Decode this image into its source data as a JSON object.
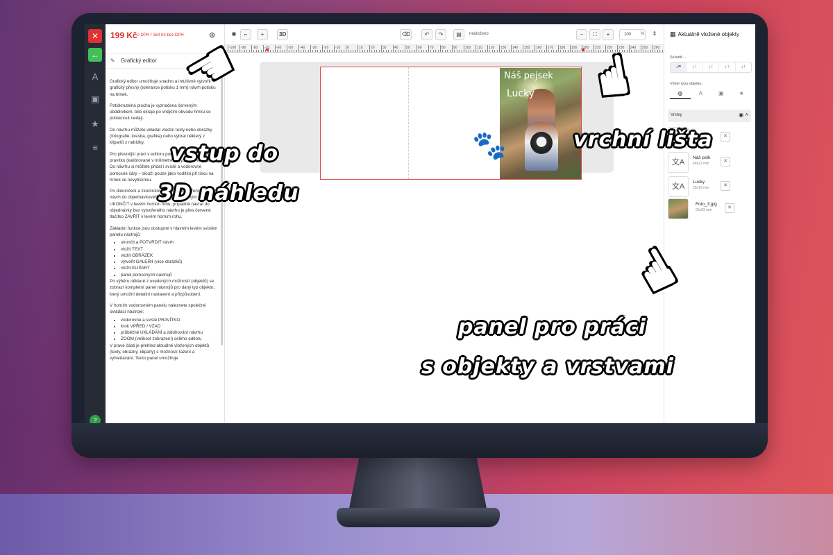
{
  "editor": {
    "price": "199 Kč",
    "price_note": "s DPH / 164 Kč bez DPH",
    "panel_title": "Grafický editor",
    "help": {
      "p1": "Grafický editor umožňuje snadno a intuitivně vytvořit grafický přesný (tolerance potisku 1 mm) návrh potisku na hrnek.",
      "p2": "Potisknutelná plocha je vyznačena červeným obdélníkem, bílé okraje po vnějším obvodu hrnku se potisknout nedají.",
      "p3": "Do návrhu můžete vkládat vlastní texty nebo obrázky (fotografie, kresba, grafika) nebo vybrat některý z klipartů z nabídky.",
      "p4": "Pro přesnější práci v editoru použijte svislé a vodorovné pravítko (kalibrované v milimetrech výsledného potisku). Do návrhu si můžete přidat i svislé a vodorovné pomocné čáry – slouží pouze jako vodítko při tisku na hrnek se nevytisknou.",
      "p5": "Po dokončení a zkontrolování vložte vytvořený grafický návrh do objednávkového formuláře zeleným tlačítkem UKONČIT v levém horním rohu, případně návrat do objednávky bez vytvořeného návrhu je přes červené tlačítko ZAVŘÍT v levém horním rohu.",
      "p6": "Základní funkce jsou dostupné v hlavním levém svislém panelu nástrojů:",
      "list1": [
        "ukončit a POTVRDIT návrh",
        "vložit TEXT",
        "vložit OBRÁZEK",
        "vytvořit GALERII (více obrázků)",
        "vložit KLIPART",
        "panel pomocných nástrojů"
      ],
      "p7": "Po výběru některé z uvedených možností (objektů) se zobrazí kompletní panel nástrojů pro daný typ objektu, který umožní detailní nastavení a přizpůsobení.",
      "p8": "V horním vodorovném panelu naleznete společné ovládací nástroje:",
      "list2": [
        "vodorovné a svislé PRAVÍTKO",
        "krok VPŘED / VZAD",
        "průběžné UKLÁDÁNÍ a zálohování návrhu",
        "ZOOM (velikost zobrazení) celého editoru"
      ],
      "p9": "V pravé části je přehled aktuálně vložených objektů (texty, obrázky, kliparty) s možností řazení a vyhledávání. Tento panel umožňuje"
    }
  },
  "toolbar": {
    "btn_3d": "3D",
    "save_status": "neuloženo",
    "zoom_value": "100",
    "zoom_unit": "%"
  },
  "ruler": {
    "labels": [
      "-100",
      "-90",
      "-80",
      "-70",
      "-60",
      "-50",
      "-40",
      "-30",
      "-20",
      "-10",
      "0",
      "10",
      "20",
      "30",
      "40",
      "50",
      "60",
      "70",
      "80",
      "90",
      "100",
      "110",
      "120",
      "130",
      "140",
      "150",
      "160",
      "170",
      "180",
      "190",
      "200",
      "210",
      "220",
      "230",
      "240",
      "250",
      "260",
      "270"
    ]
  },
  "canvas": {
    "photo_text_1": "Náš pejsek",
    "photo_text_2": "Lucky"
  },
  "right_panel": {
    "title": "Aktuálně vložené objekty",
    "sort_label": "Seřadit ...",
    "type_label": "Výběr typu objektu",
    "layers_label": "Vrstvy",
    "layers": [
      {
        "name": "",
        "dim": "",
        "icon": "translate-icon"
      },
      {
        "name": "Náš psík",
        "dim": "49x22 mm",
        "icon": "translate-icon"
      },
      {
        "name": "Lucky",
        "dim": "29x19 mm",
        "icon": "translate-icon"
      },
      {
        "name": "Foto_3.jpg",
        "dim": "62x93 mm",
        "icon": "image-thumb"
      }
    ]
  },
  "annotations": {
    "a1_line1": "vstup do",
    "a1_line2": "3D náhledu",
    "a2": "vrchní lišta",
    "a3_line1": "panel pro práci",
    "a3_line2": "s objekty a vrstvami"
  },
  "colors": {
    "close_red": "#e03131",
    "confirm_green": "#40c057",
    "price_red": "#d6312f",
    "rail_dark": "#262b36"
  }
}
